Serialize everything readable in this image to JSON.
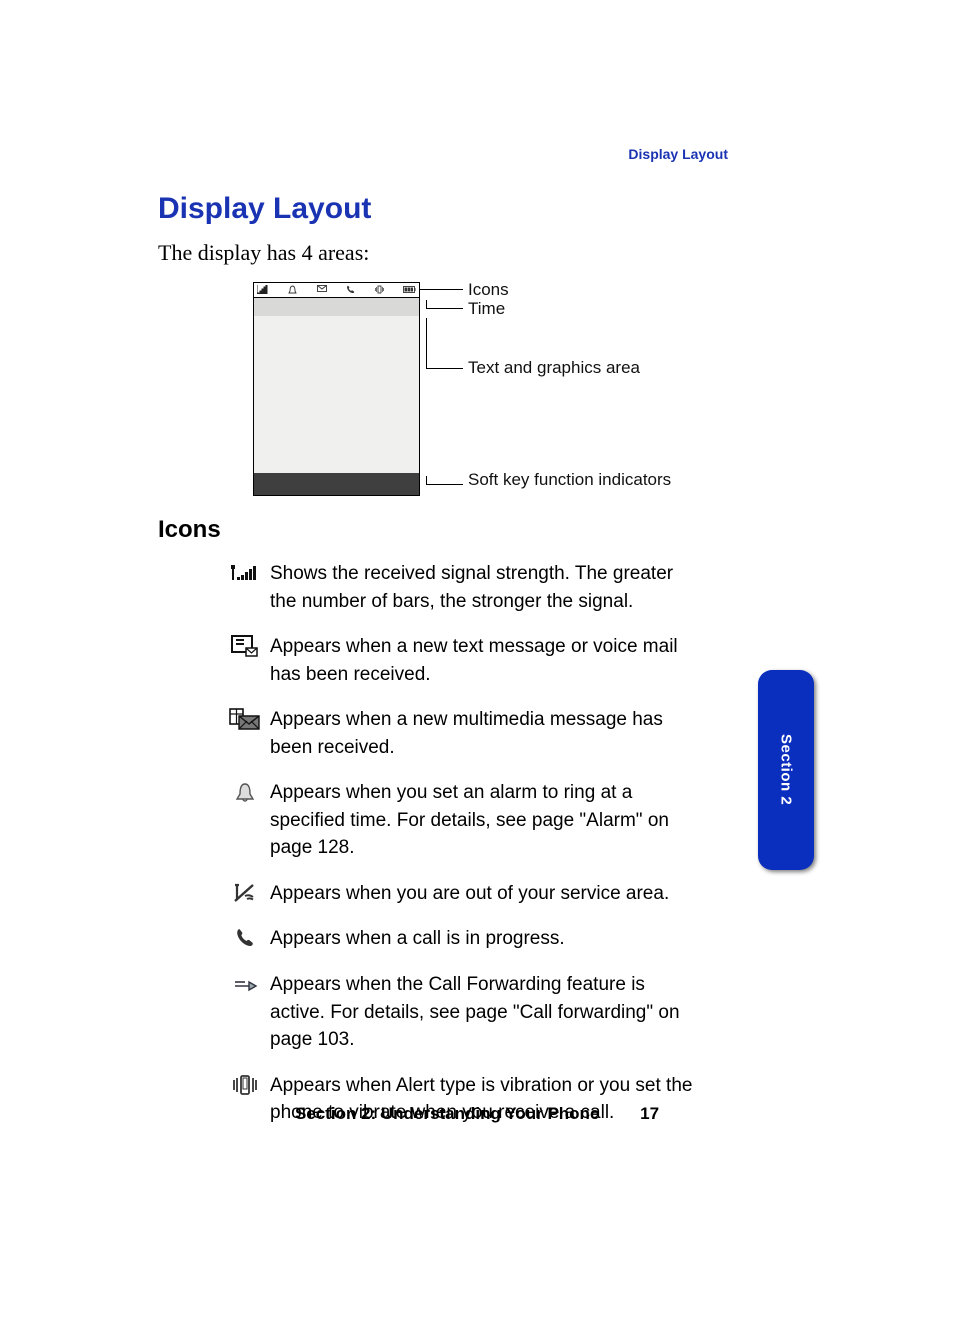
{
  "runningHead": "Display Layout",
  "heading1": "Display Layout",
  "intro": "The display has 4 areas:",
  "diagram": {
    "labels": {
      "icons": "Icons",
      "time": "Time",
      "textArea": "Text and graphics area",
      "softKeys": "Soft key function indicators"
    }
  },
  "heading2": "Icons",
  "icons": [
    {
      "name": "signal-strength-icon",
      "desc": "Shows the received signal strength. The greater the number of bars, the stronger the signal."
    },
    {
      "name": "message-icon",
      "desc": "Appears when a new text message or voice mail has been received."
    },
    {
      "name": "mms-icon",
      "desc": "Appears when a new multimedia message has been received."
    },
    {
      "name": "alarm-icon",
      "desc": "Appears when you set an alarm to ring at a specified time. For details, see page \"Alarm\" on page 128."
    },
    {
      "name": "no-service-icon",
      "desc": "Appears when you are out of your service area."
    },
    {
      "name": "call-in-progress-icon",
      "desc": "Appears when a call is in progress."
    },
    {
      "name": "call-forwarding-icon",
      "desc": "Appears when the Call Forwarding feature is active. For details, see page \"Call forwarding\" on page 103."
    },
    {
      "name": "vibration-icon",
      "desc": "Appears when Alert type is vibration or you set the phone to vibrate when you receive a call."
    }
  ],
  "sideTab": "Section 2",
  "footer": {
    "section": "Section 2: Understanding Your Phone",
    "page": "17"
  }
}
